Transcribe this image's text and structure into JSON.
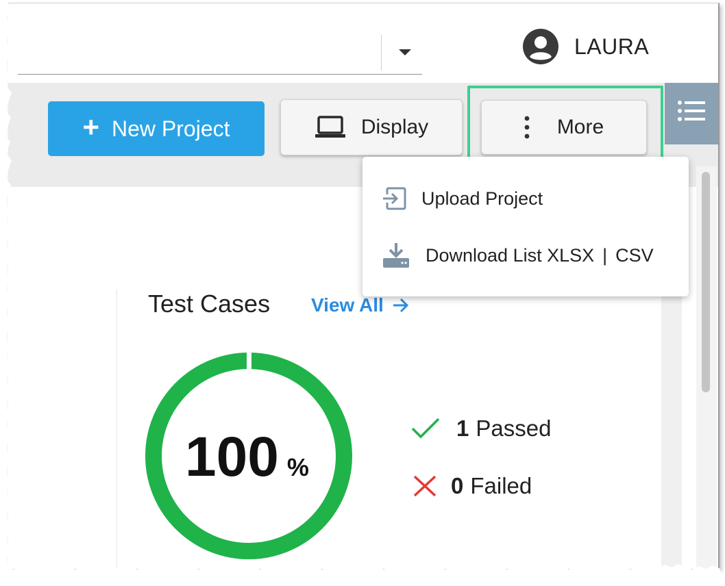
{
  "header": {
    "user_name": "LAURA"
  },
  "toolbar": {
    "new_project": "New Project",
    "display": "Display",
    "more": "More"
  },
  "more_menu": {
    "upload": "Upload Project",
    "download": "Download List XLSX",
    "download_sep": "|",
    "download_csv": "CSV"
  },
  "test_cases": {
    "title": "Test Cases",
    "view_all": "View All",
    "percent": "100",
    "percent_sign": "%",
    "passed_count": "1",
    "passed_label": "Passed",
    "failed_count": "0",
    "failed_label": "Failed",
    "pass_fraction": 1.0
  },
  "colors": {
    "primary": "#2aa3e6",
    "highlight": "#3ecf8e",
    "pass": "#1fb34a",
    "fail": "#e53935",
    "link": "#2a8ce0"
  },
  "icons": [
    "user-avatar-icon",
    "laptop-icon",
    "more-vertical-icon",
    "list-icon",
    "upload-icon",
    "download-icon",
    "arrow-right-icon",
    "check-icon",
    "x-icon",
    "plus-icon"
  ]
}
